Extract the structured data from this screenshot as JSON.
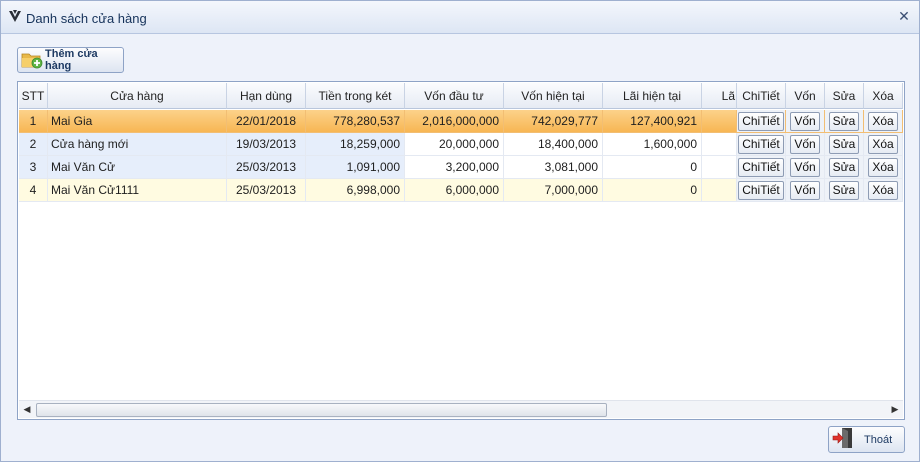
{
  "window": {
    "title": "Danh sách cửa hàng",
    "close_glyph": "✕"
  },
  "toolbar": {
    "add_store_label": "Thêm cửa hàng",
    "add_icon": "folder-add-icon"
  },
  "table": {
    "headers": [
      "STT",
      "Cửa hàng",
      "Hạn dùng",
      "Tiền trong két",
      "Vốn đầu tư",
      "Vốn hiện tại",
      "Lãi hiện tại",
      "Lã",
      "ChiTiết",
      "Vốn",
      "Sửa",
      "Xóa"
    ],
    "rows": [
      {
        "stt": "1",
        "store": "Mai Gia",
        "expiry": "22/01/2018",
        "cash": "778,280,537",
        "invest": "2,016,000,000",
        "capital": "742,029,777",
        "profit": "127,400,921",
        "extra": "",
        "detail": "ChiTiết",
        "von": "Vốn",
        "sua": "Sửa",
        "xoa": "Xóa"
      },
      {
        "stt": "2",
        "store": "Cửa hàng mới",
        "expiry": "19/03/2013",
        "cash": "18,259,000",
        "invest": "20,000,000",
        "capital": "18,400,000",
        "profit": "1,600,000",
        "extra": "",
        "detail": "ChiTiết",
        "von": "Vốn",
        "sua": "Sửa",
        "xoa": "Xóa"
      },
      {
        "stt": "3",
        "store": "Mai Văn Cử",
        "expiry": "25/03/2013",
        "cash": "1,091,000",
        "invest": "3,200,000",
        "capital": "3,081,000",
        "profit": "0",
        "extra": "",
        "detail": "ChiTiết",
        "von": "Vốn",
        "sua": "Sửa",
        "xoa": "Xóa"
      },
      {
        "stt": "4",
        "store": "Mai Văn Cử1111",
        "expiry": "25/03/2013",
        "cash": "6,998,000",
        "invest": "6,000,000",
        "capital": "7,000,000",
        "profit": "0",
        "extra": "",
        "detail": "ChiTiết",
        "von": "Vốn",
        "sua": "Sửa",
        "xoa": "Xóa"
      }
    ]
  },
  "scrollbar": {
    "left_arrow": "◀",
    "right_arrow": "▶"
  },
  "footer": {
    "exit_label": "Thoát",
    "exit_icon": "exit-door-icon"
  },
  "colors": {
    "selected_row": "#f7b551",
    "alt_row_blue": "#e6eefb",
    "alt_row_yellow": "#fffbe1",
    "title_text": "#15325a"
  }
}
